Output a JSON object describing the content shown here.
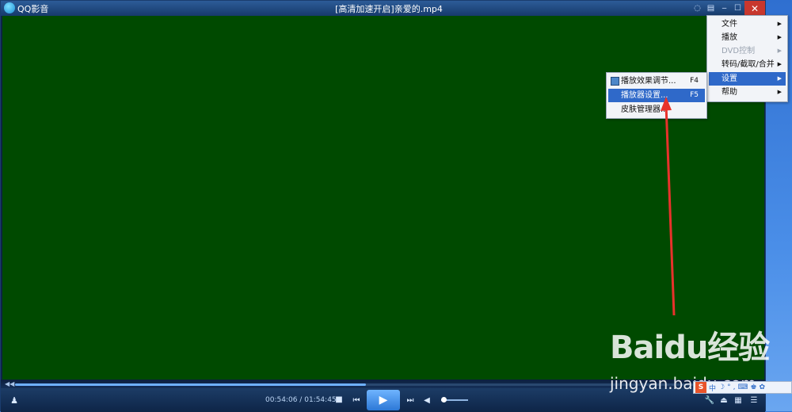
{
  "app": {
    "name": "QQ影音",
    "window_title": "[高清加速开启]亲爱的.mp4"
  },
  "titlebar": {
    "buttons": [
      "skin-icon",
      "menu-icon",
      "minimize-icon",
      "maximize-icon",
      "close-icon"
    ],
    "close_symbol": "✕",
    "min_symbol": "‒",
    "max_symbol": "☐",
    "menu_symbol": "▤",
    "skin_symbol": "◌"
  },
  "playback": {
    "current_time": "00:54:06",
    "separator": "/",
    "total_time": "01:54:45",
    "progress": 0.471,
    "volume": 0.1
  },
  "main_menu": {
    "items": [
      {
        "label": "文件",
        "submenu": true,
        "disabled": false
      },
      {
        "label": "播放",
        "submenu": true,
        "disabled": false
      },
      {
        "label": "DVD控制",
        "submenu": true,
        "disabled": true
      },
      {
        "label": "转码/截取/合并",
        "submenu": true,
        "disabled": false
      },
      {
        "label": "设置",
        "submenu": true,
        "disabled": false,
        "highlighted": true
      },
      {
        "label": "帮助",
        "submenu": true,
        "disabled": false
      }
    ]
  },
  "settings_menu": {
    "items": [
      {
        "label": "播放效果调节...",
        "shortcut": "F4"
      },
      {
        "label": "播放器设置...",
        "shortcut": "F5",
        "highlighted": true
      },
      {
        "label": "皮肤管理器..."
      }
    ]
  },
  "watermark": {
    "brand": "Baidu经验",
    "url": "jingyan.baidu.com"
  },
  "tray": {
    "logo": "S",
    "items": [
      "中",
      "☽",
      "°",
      ",",
      "⌨",
      "♚",
      "✿"
    ]
  },
  "colors": {
    "video_bg": "#004a00",
    "accent": "#2f69c9",
    "close": "#c8372e",
    "annotation_arrow": "#e8322b"
  }
}
